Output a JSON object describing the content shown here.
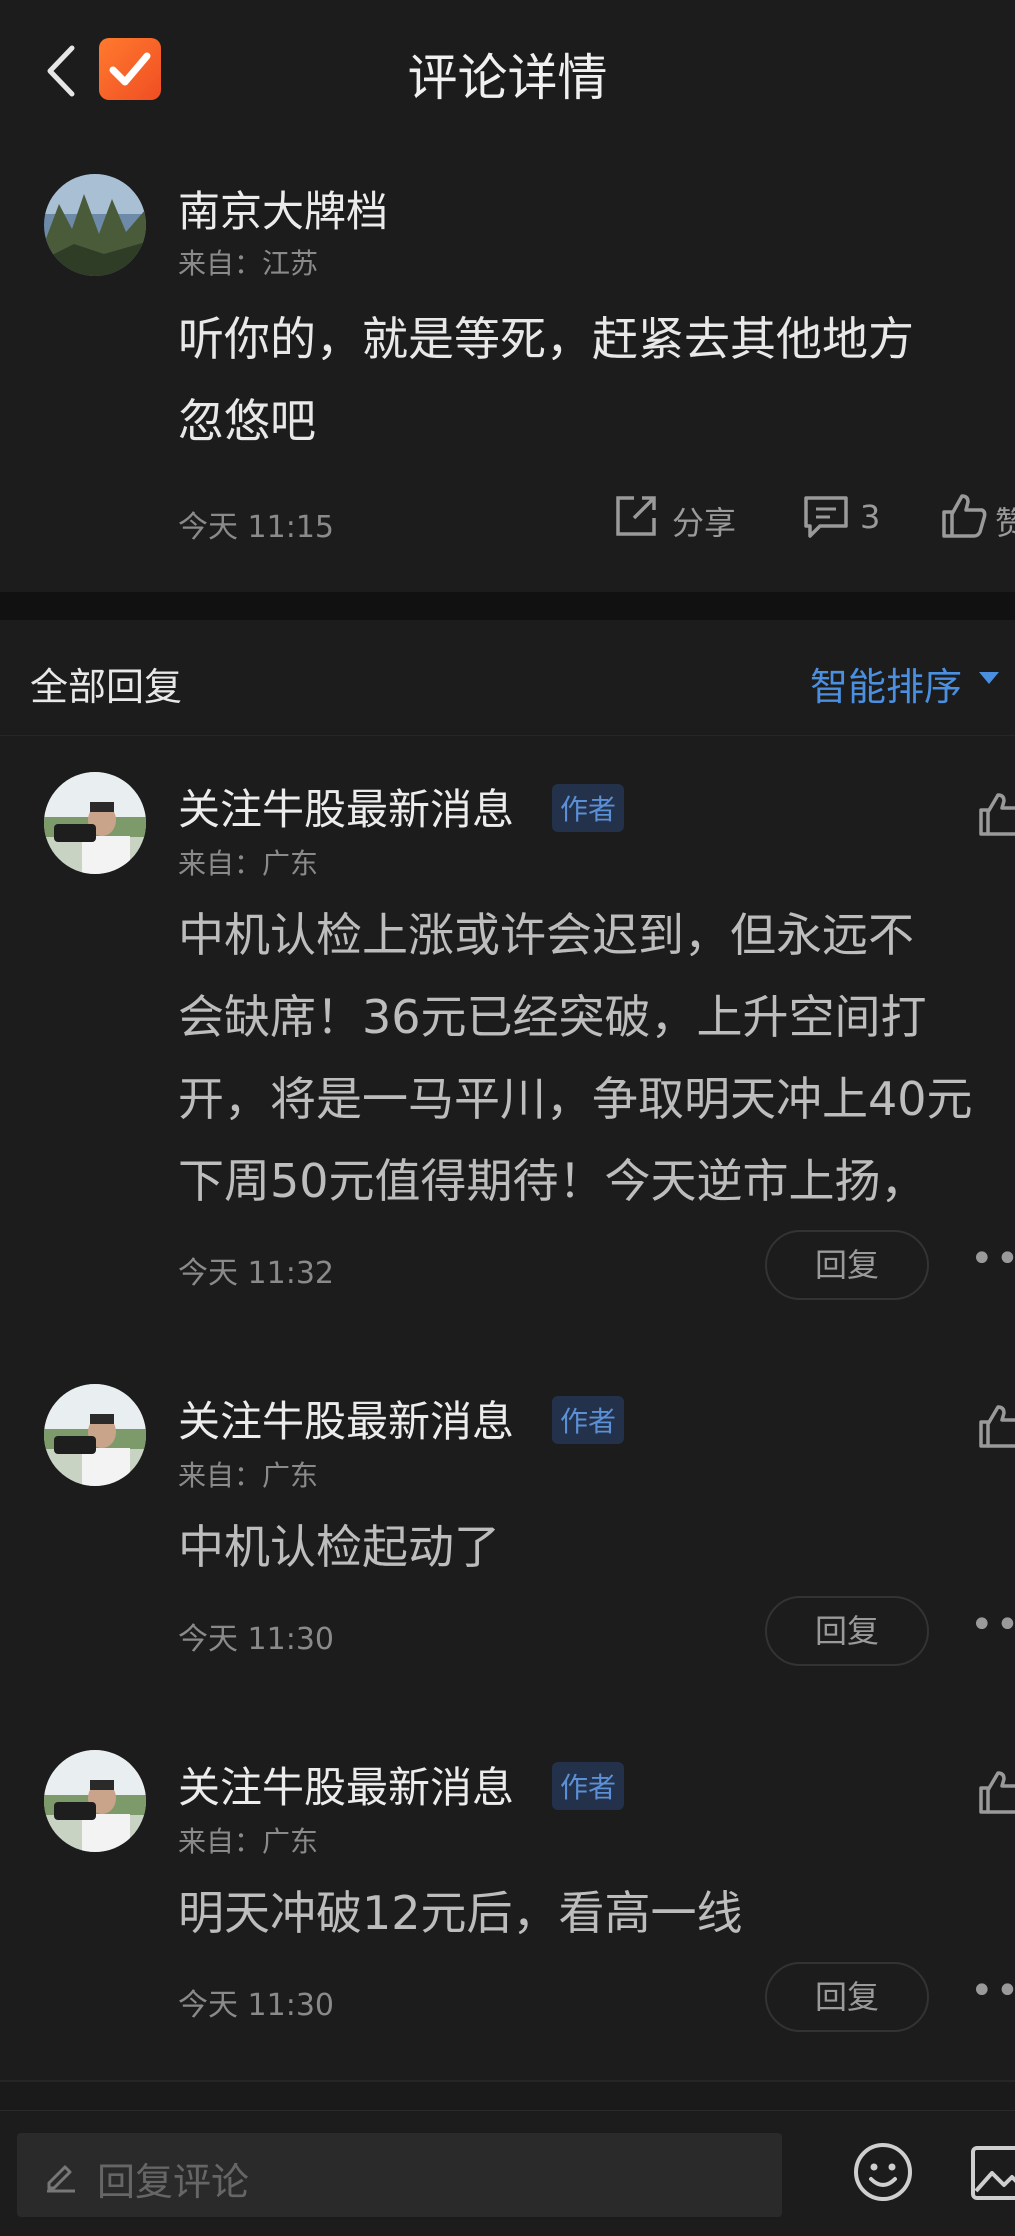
{
  "header": {
    "title": "评论详情"
  },
  "main_comment": {
    "username": "南京大牌档",
    "origin": "来自：江苏",
    "text_line1": "听你的，就是等死，赶紧去其他地方",
    "text_line2": "忽悠吧",
    "time": "今天 11:15",
    "share_label": "分享",
    "reply_count": "3",
    "like_label": "赞"
  },
  "replies_header": {
    "title": "全部回复",
    "sort_label": "智能排序"
  },
  "replies": [
    {
      "username": "关注牛股最新消息",
      "badge": "作者",
      "origin": "来自：广东",
      "lines": [
        "中机认检上涨或许会迟到，但永远不",
        "会缺席！36元已经突破，上升空间打",
        "开，将是一马平川，争取明天冲上40元",
        "下周50元值得期待！今天逆市上扬，"
      ],
      "time": "今天 11:32",
      "reply_label": "回复"
    },
    {
      "username": "关注牛股最新消息",
      "badge": "作者",
      "origin": "来自：广东",
      "lines": [
        "中机认检起动了"
      ],
      "time": "今天 11:30",
      "reply_label": "回复"
    },
    {
      "username": "关注牛股最新消息",
      "badge": "作者",
      "origin": "来自：广东",
      "lines": [
        "明天冲破12元后，看高一线"
      ],
      "time": "今天 11:30",
      "reply_label": "回复"
    }
  ],
  "bottom_bar": {
    "placeholder": "回复评论"
  },
  "icons": {
    "back": "chevron-left-icon",
    "app": "checkbox-app-icon",
    "share": "share-icon",
    "comment": "comment-icon",
    "like": "thumbs-up-icon",
    "pencil": "pencil-icon",
    "emoji": "smiley-icon",
    "image": "image-icon"
  },
  "colors": {
    "accent_blue": "#4a8fe0",
    "app_orange": "#f04e23",
    "background": "#1a1a1a"
  }
}
